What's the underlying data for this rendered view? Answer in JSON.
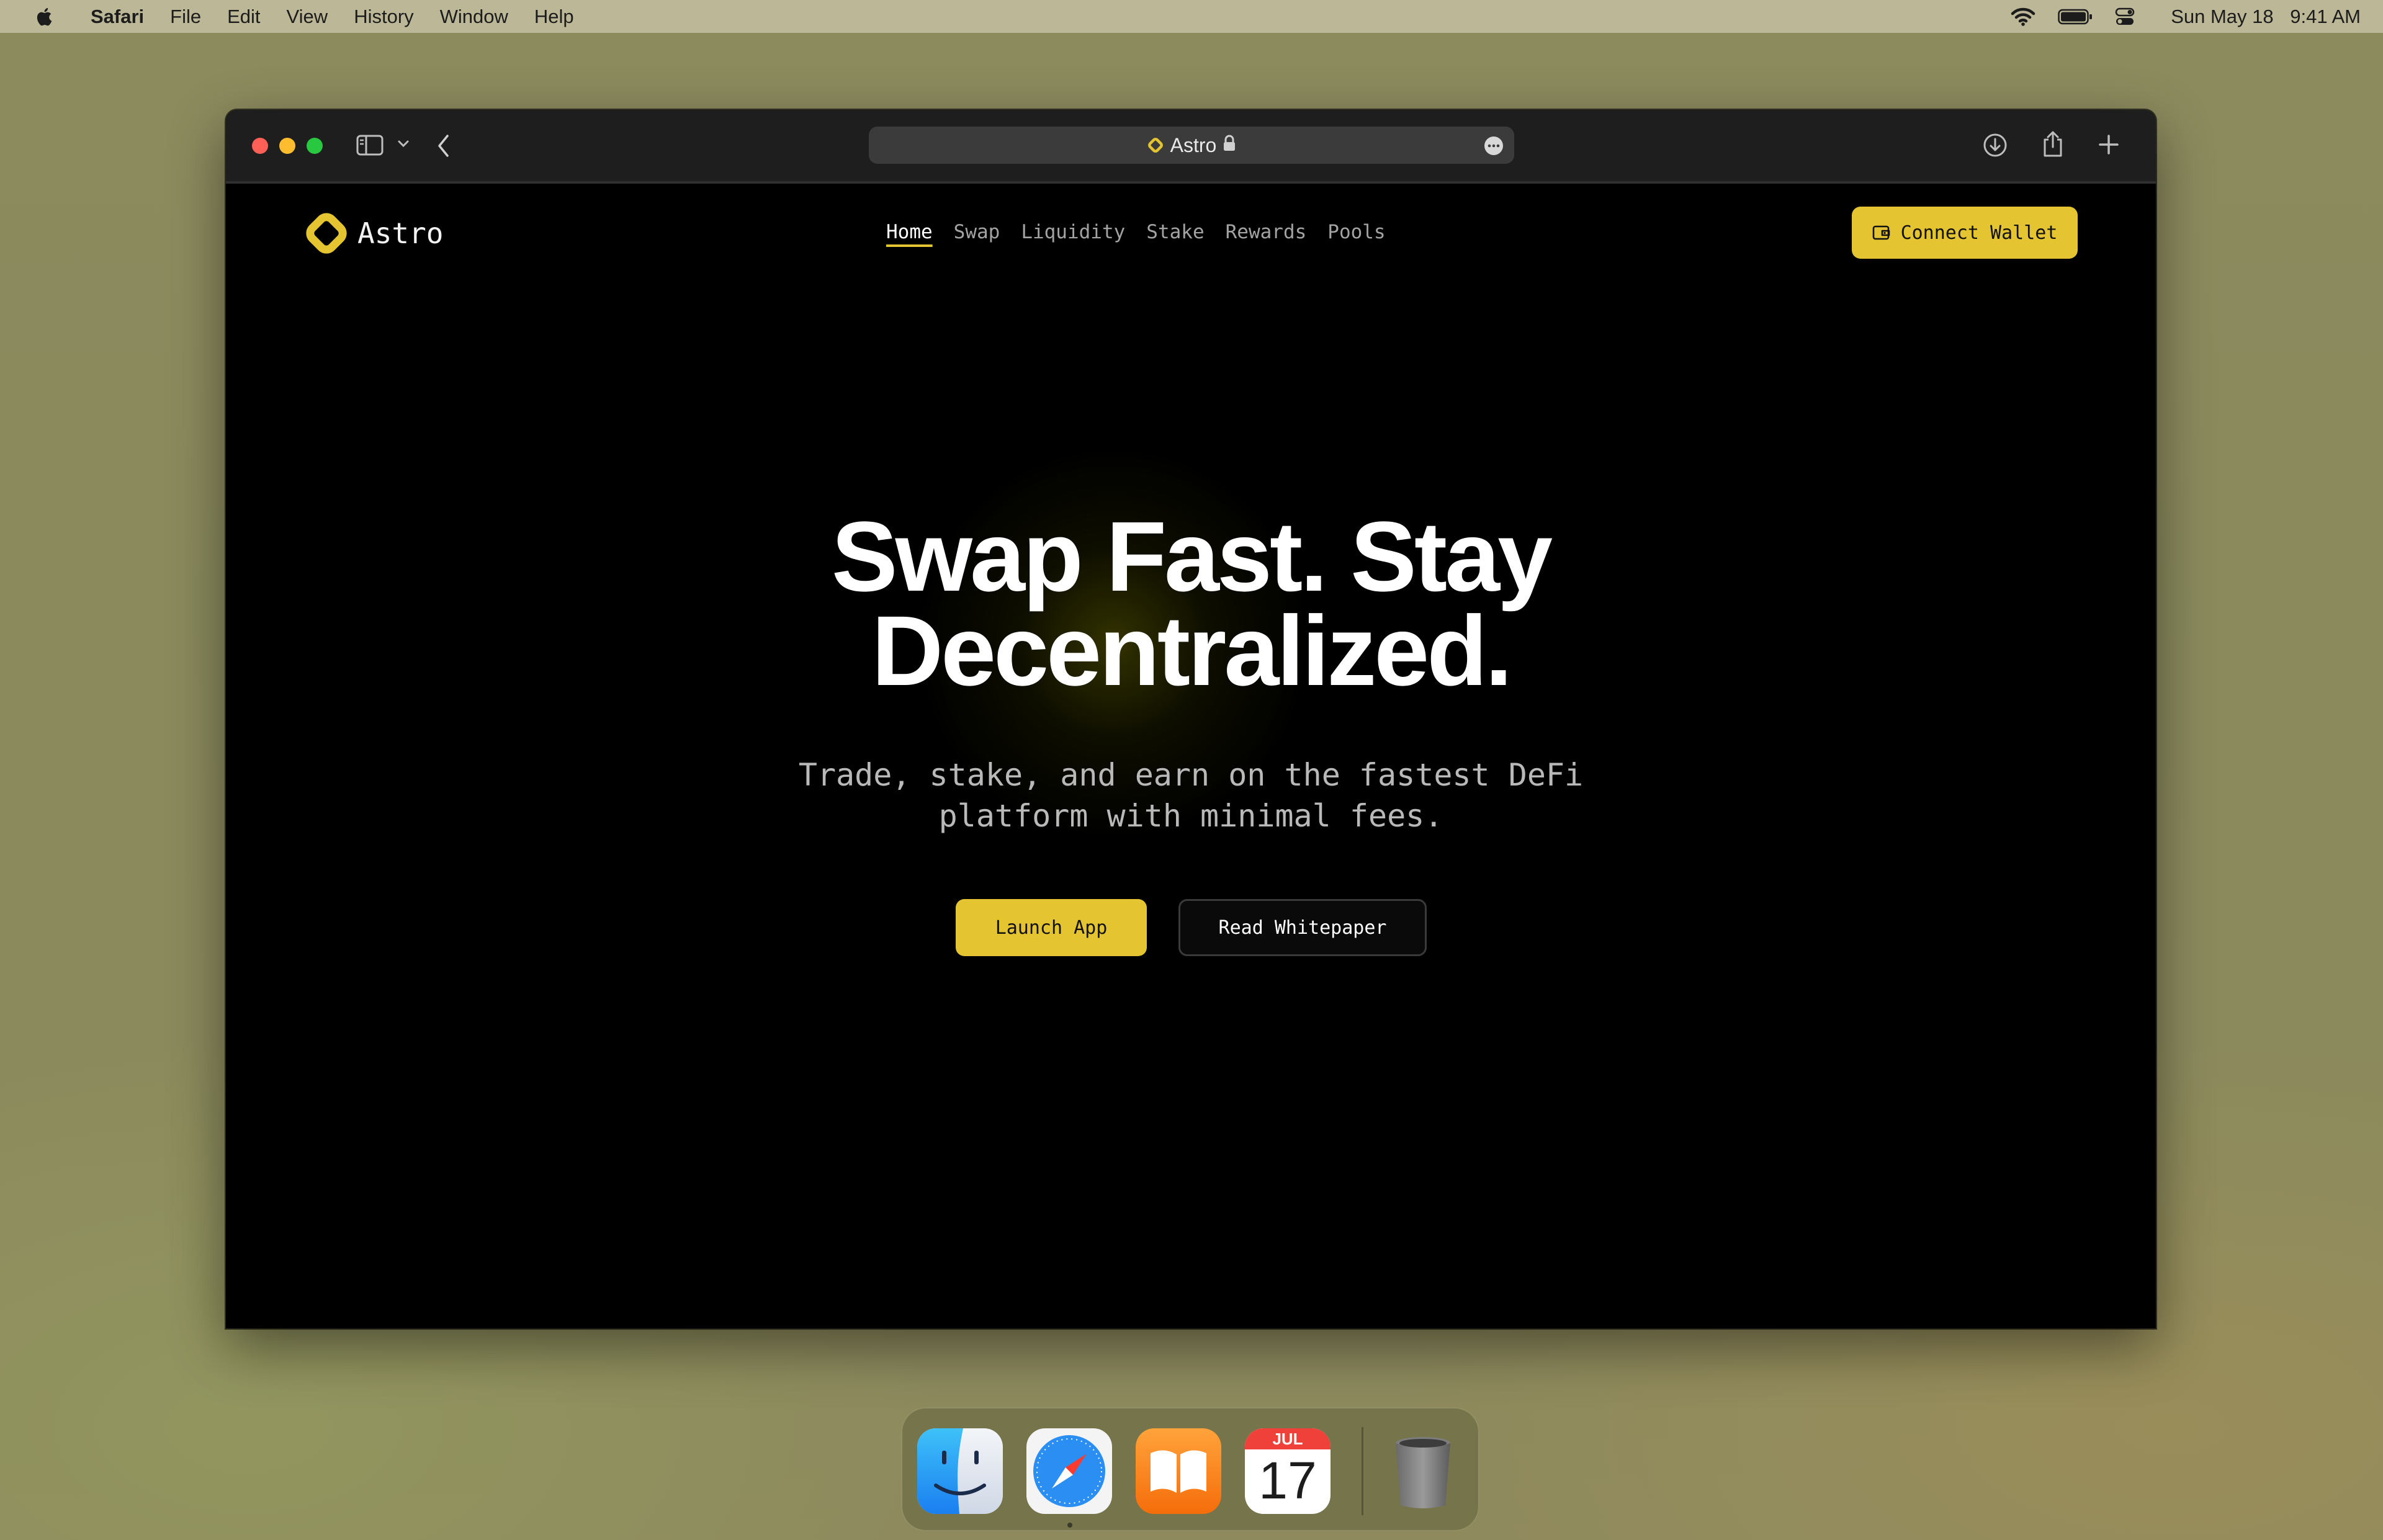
{
  "menubar": {
    "app_name": "Safari",
    "items": [
      "File",
      "Edit",
      "View",
      "History",
      "Window",
      "Help"
    ],
    "date": "Sun May 18",
    "time": "9:41 AM"
  },
  "browser": {
    "tab_title": "Astro",
    "icons": [
      "sidebar-icon",
      "chevron-down-icon",
      "back-icon",
      "lock-icon",
      "more-icon",
      "download-icon",
      "share-icon",
      "new-tab-icon"
    ]
  },
  "site": {
    "brand": "Astro",
    "brand_color": "#e4c431",
    "nav": [
      "Home",
      "Swap",
      "Liquidity",
      "Stake",
      "Rewards",
      "Pools"
    ],
    "active_nav": "Home",
    "connect_label": "Connect Wallet",
    "headline_line1": "Swap Fast. Stay",
    "headline_line2": "Decentralized.",
    "subtitle_line1": "Trade, stake, and earn on the fastest DeFi",
    "subtitle_line2": "platform with minimal fees.",
    "primary_cta": "Launch App",
    "secondary_cta": "Read Whitepaper"
  },
  "dock": {
    "apps": [
      "Finder",
      "Safari",
      "Books",
      "Calendar",
      "Trash"
    ],
    "calendar_month": "JUL",
    "calendar_day": "17"
  }
}
